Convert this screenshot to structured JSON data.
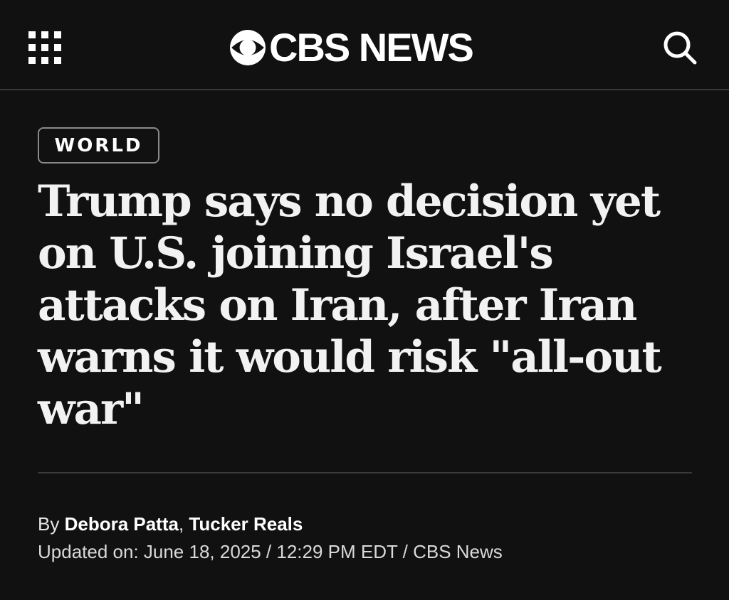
{
  "header": {
    "menu_icon": "grid-menu-icon",
    "logo_icon": "cbs-eye-icon",
    "logo_text": "CBS NEWS",
    "search_icon": "search-icon"
  },
  "article": {
    "category": "WORLD",
    "headline": "Trump says no decision yet on U.S. joining Israel's attacks on Iran, after Iran warns it would risk \"all-out war\"",
    "byline_prefix": "By ",
    "author_1": "Debora Patta",
    "author_separator": ", ",
    "author_2": "Tucker Reals",
    "updated": "Updated on: June 18, 2025 / 12:29 PM EDT / CBS News"
  },
  "colors": {
    "background": "#111111",
    "text": "#f2f2f2",
    "divider": "#3a3a3a",
    "badge_border": "#8a8a8a"
  }
}
